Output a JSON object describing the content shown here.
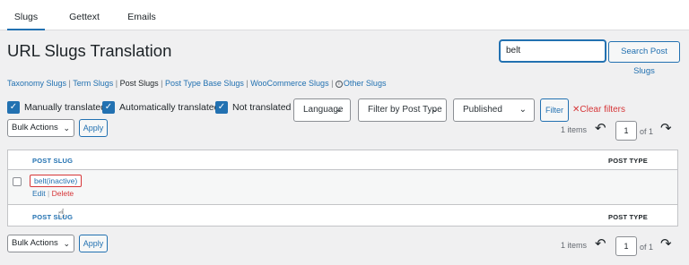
{
  "tabs": [
    "Slugs",
    "Gettext",
    "Emails"
  ],
  "page_title": "URL Slugs Translation",
  "search": {
    "value": "belt",
    "button": "Search Post Slugs"
  },
  "sublinks": {
    "taxonomy": "Taxonomy Slugs",
    "term": "Term Slugs",
    "post": "Post Slugs",
    "post_type_base": "Post Type Base Slugs",
    "woocommerce": "WooCommerce Slugs",
    "other": "Other Slugs",
    "separator": " | "
  },
  "filters": {
    "manually": "Manually translated",
    "automatically": "Automatically translated",
    "not_translated": "Not translated",
    "language": "Language",
    "post_type": "Filter by Post Type",
    "status": "Published",
    "filter_button": "Filter",
    "clear": "Clear filters"
  },
  "bulk": {
    "label": "Bulk Actions",
    "apply": "Apply"
  },
  "pagination": {
    "items": "1 items",
    "current": "1",
    "of": "of 1"
  },
  "table": {
    "col_slug": "POST SLUG",
    "col_type": "POST TYPE",
    "rows": [
      {
        "slug": "belt(inactive)",
        "post_type": "",
        "edit": "Edit",
        "delete": "Delete"
      }
    ]
  },
  "colors": {
    "accent": "#2271b1",
    "danger": "#d63638",
    "background": "#f0f0f1"
  },
  "icons": [
    "checkbox-checked-icon",
    "chevron-down-icon",
    "close-icon",
    "info-icon",
    "undo-arrow-icon",
    "redo-arrow-icon",
    "hand-pointer-icon"
  ]
}
